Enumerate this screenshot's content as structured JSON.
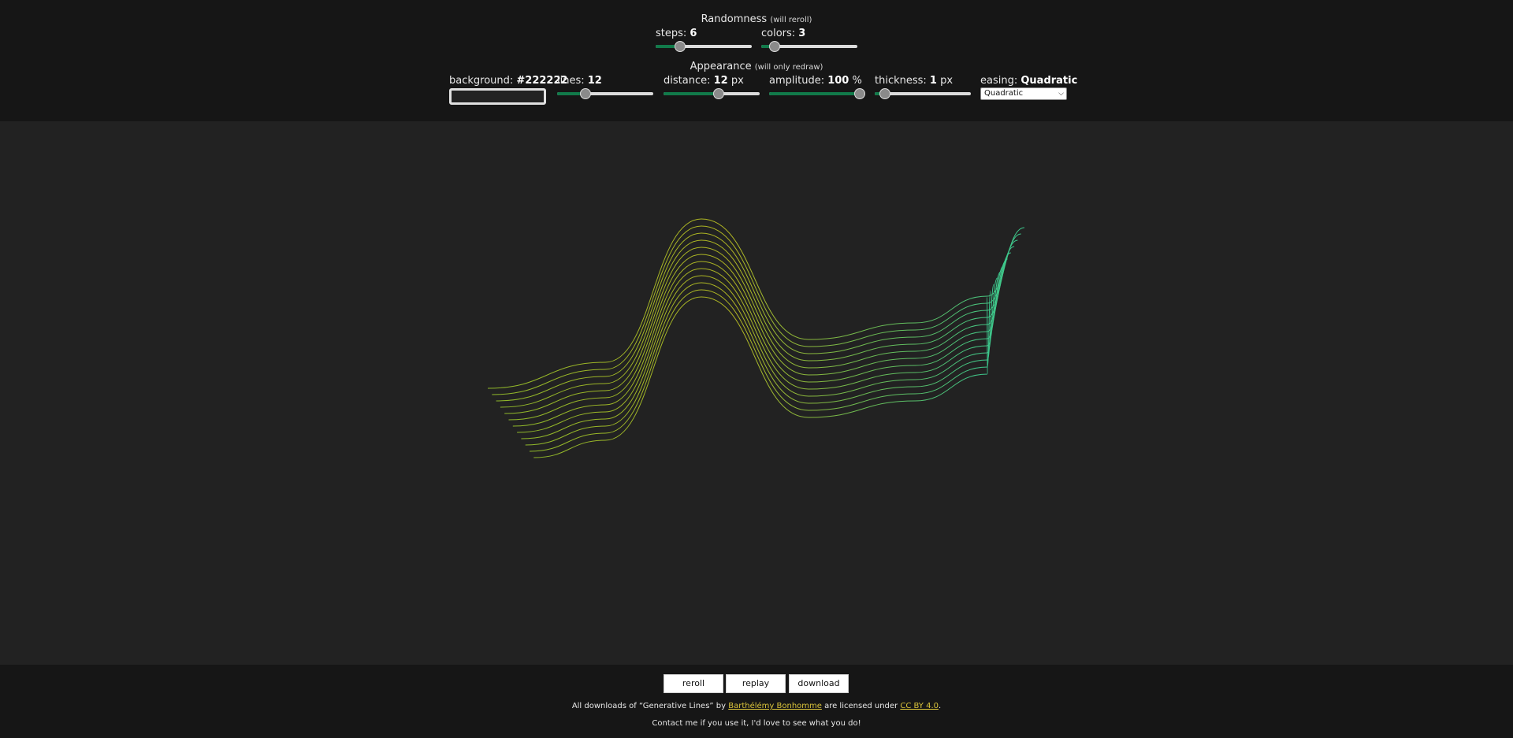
{
  "randomness": {
    "title": "Randomness",
    "hint": "(will reroll)",
    "steps": {
      "label": "steps: ",
      "value": "6",
      "fraction": 0.22
    },
    "colors": {
      "label": "colors: ",
      "value": "3",
      "fraction": 0.09
    }
  },
  "appearance": {
    "title": "Appearance",
    "hint": "(will only redraw)",
    "background": {
      "label": "background: ",
      "value": "#222222"
    },
    "lines": {
      "label": "lines: ",
      "value": "12",
      "fraction": 0.27
    },
    "distance": {
      "label": "distance: ",
      "value": "12",
      "unit": " px",
      "fraction": 0.58
    },
    "amplitude": {
      "label": "amplitude: ",
      "value": "100",
      "unit": " %",
      "fraction": 1.0
    },
    "thickness": {
      "label": "thickness: ",
      "value": "1",
      "unit": " px",
      "fraction": 0.06
    },
    "easing": {
      "label": "easing: ",
      "value": "Quadratic",
      "selected": "Quadratic"
    }
  },
  "colors": {
    "background": "#222222",
    "panel": "#161616",
    "slider_fill": "#117a4a",
    "line_start": "#8fb82a",
    "line_mid": "#b0b422",
    "line_end": "#3cc88e"
  },
  "artwork": {
    "line_count": 12
  },
  "buttons": {
    "reroll": "reroll",
    "replay": "replay",
    "download": "download"
  },
  "footer": {
    "prefix": "All downloads of “Generative Lines” by ",
    "author": "Barthélémy Bonhomme",
    "middle": " are licensed under ",
    "license": "CC BY 4.0",
    "suffix": ".",
    "contact": "Contact me if you use it, I'd love to see what you do!"
  }
}
